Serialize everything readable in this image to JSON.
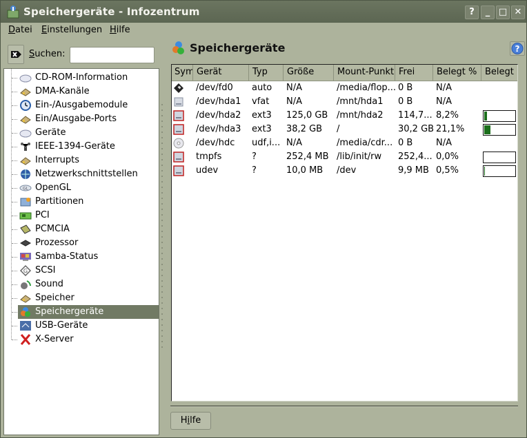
{
  "window": {
    "title": "Speichergeräte - Infozentrum",
    "buttons": {
      "help": "?",
      "minimize": "_",
      "maximize": "□",
      "close": "✕"
    }
  },
  "menubar": {
    "items": [
      {
        "label": "Datei",
        "accel": "D",
        "rest": "atei"
      },
      {
        "label": "Einstellungen",
        "accel": "E",
        "rest": "instellungen"
      },
      {
        "label": "Hilfe",
        "accel": "H",
        "rest": "ilfe"
      }
    ]
  },
  "search": {
    "label_accel": "S",
    "label_rest": "uchen:",
    "value": "",
    "placeholder": "",
    "clear_icon": "clear-text-icon"
  },
  "sidebar": {
    "selected_index": 17,
    "items": [
      {
        "label": "CD-ROM-Information",
        "icon": "cdrom-icon"
      },
      {
        "label": "DMA-Kanäle",
        "icon": "memory-chip-icon"
      },
      {
        "label": "Ein-/Ausgabemodule",
        "icon": "clock-icon"
      },
      {
        "label": "Ein/Ausgabe-Ports",
        "icon": "memory-chip-icon"
      },
      {
        "label": "Geräte",
        "icon": "device-icon"
      },
      {
        "label": "IEEE-1394-Geräte",
        "icon": "network-nodes-icon"
      },
      {
        "label": "Interrupts",
        "icon": "memory-chip-icon"
      },
      {
        "label": "Netzwerkschnittstellen",
        "icon": "globe-icon"
      },
      {
        "label": "OpenGL",
        "icon": "opengl-icon"
      },
      {
        "label": "Partitionen",
        "icon": "partition-icon"
      },
      {
        "label": "PCI",
        "icon": "pci-card-icon"
      },
      {
        "label": "PCMCIA",
        "icon": "pcmcia-card-icon"
      },
      {
        "label": "Prozessor",
        "icon": "cpu-icon"
      },
      {
        "label": "Samba-Status",
        "icon": "monitor-icon"
      },
      {
        "label": "SCSI",
        "icon": "scsi-icon"
      },
      {
        "label": "Sound",
        "icon": "speaker-icon"
      },
      {
        "label": "Speicher",
        "icon": "memory-chip-icon"
      },
      {
        "label": "Speichergeräte",
        "icon": "storage-devices-icon"
      },
      {
        "label": "USB-Geräte",
        "icon": "usb-icon"
      },
      {
        "label": "X-Server",
        "icon": "x-server-icon"
      }
    ]
  },
  "main": {
    "title": "Speichergeräte",
    "help_icon": "help-icon",
    "columns": [
      "Sym",
      "Gerät",
      "Typ",
      "Größe",
      "Mount-Punkt",
      "Frei",
      "Belegt %",
      "Belegt"
    ],
    "rows": [
      {
        "sym": "floppy-icon",
        "device": "/dev/fd0",
        "type": "auto",
        "size": "N/A",
        "mount": "/media/flop...",
        "free": "0 B",
        "used_pct": "N/A",
        "bar": null
      },
      {
        "sym": "harddisk-unmounted-icon",
        "device": "/dev/hda1",
        "type": "vfat",
        "size": "N/A",
        "mount": "/mnt/hda1",
        "free": "0 B",
        "used_pct": "N/A",
        "bar": null
      },
      {
        "sym": "harddisk-mounted-icon",
        "device": "/dev/hda2",
        "type": "ext3",
        "size": "125,0 GB",
        "mount": "/mnt/hda2",
        "free": "114,7...",
        "used_pct": "8,2%",
        "bar": 8.2
      },
      {
        "sym": "harddisk-mounted-icon",
        "device": "/dev/hda3",
        "type": "ext3",
        "size": "38,2 GB",
        "mount": "/",
        "free": "30,2 GB",
        "used_pct": "21,1%",
        "bar": 21.1
      },
      {
        "sym": "cdrom-disc-icon",
        "device": "/dev/hdc",
        "type": "udf,i...",
        "size": "N/A",
        "mount": "/media/cdr...",
        "free": "0 B",
        "used_pct": "N/A",
        "bar": null
      },
      {
        "sym": "harddisk-mounted-icon",
        "device": "tmpfs",
        "type": "?",
        "size": "252,4 MB",
        "mount": "/lib/init/rw",
        "free": "252,4...",
        "used_pct": "0,0%",
        "bar": 0.0
      },
      {
        "sym": "harddisk-mounted-icon",
        "device": "udev",
        "type": "?",
        "size": "10,0 MB",
        "mount": "/dev",
        "free": "9,9 MB",
        "used_pct": "0,5%",
        "bar": 0.5
      }
    ]
  },
  "footer": {
    "help_button": {
      "accel": "i",
      "pre": "H",
      "post": "lfe",
      "label": "Hilfe"
    }
  },
  "colors": {
    "selection": "#717a64",
    "bar_fill": "#1b6e1b",
    "window_bg": "#adb39c",
    "titlebar": "#616b57"
  }
}
